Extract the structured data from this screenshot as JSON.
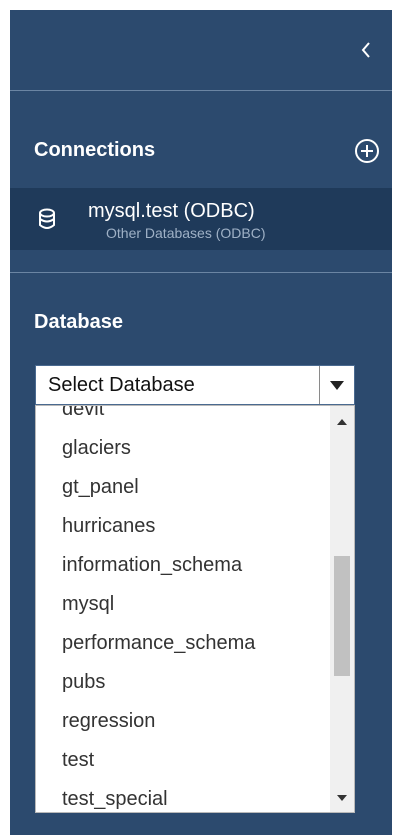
{
  "panel": {
    "collapse_icon": "chevron-left-icon",
    "background": "#2c4a6e",
    "selected_background": "#1f3a5a"
  },
  "connections": {
    "title": "Connections",
    "add_icon": "plus-circle-icon",
    "items": [
      {
        "icon": "database-icon",
        "name": "mysql.test (ODBC)",
        "type": "Other Databases (ODBC)"
      }
    ]
  },
  "database": {
    "title": "Database",
    "select": {
      "value": "Select Database",
      "arrow_icon": "caret-down-icon"
    },
    "options": [
      "devit",
      "glaciers",
      "gt_panel",
      "hurricanes",
      "information_schema",
      "mysql",
      "performance_schema",
      "pubs",
      "regression",
      "test",
      "test_special"
    ]
  }
}
